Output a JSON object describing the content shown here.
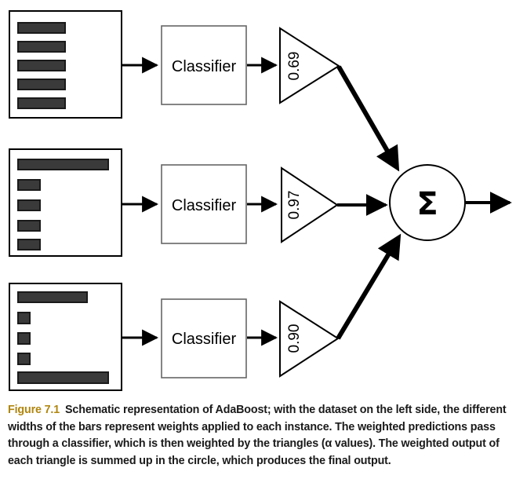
{
  "figure": {
    "label": "Figure 7.1",
    "caption": "Schematic representation of AdaBoost; with the dataset on the left side, the different widths of the bars represent weights applied to each instance. The weighted predictions pass through a classifier, which is then weighted by the triangles (α values). The weighted output of each triangle is summed up in the circle, which produces the final output.",
    "label_color": "#b0860f"
  },
  "diagram": {
    "title": "AdaBoost schematic",
    "bar_color": "#3a3a3a",
    "bar_outline_color": "#1a1a1a",
    "stroke_color": "#000000",
    "box_fill": "#ffffff",
    "rows": [
      {
        "id": "row-1",
        "dataset_label": "dataset-box-1",
        "bars": [
          {
            "label": "weight-bar",
            "width": 60
          },
          {
            "label": "weight-bar",
            "width": 60
          },
          {
            "label": "weight-bar",
            "width": 60
          },
          {
            "label": "weight-bar",
            "width": 60
          },
          {
            "label": "weight-bar",
            "width": 60
          }
        ],
        "classifier_label": "Classifier",
        "alpha_value": "0.69"
      },
      {
        "id": "row-2",
        "dataset_label": "dataset-box-2",
        "bars": [
          {
            "label": "weight-bar",
            "width": 115
          },
          {
            "label": "weight-bar",
            "width": 28
          },
          {
            "label": "weight-bar",
            "width": 28
          },
          {
            "label": "weight-bar",
            "width": 28
          },
          {
            "label": "weight-bar",
            "width": 28
          }
        ],
        "classifier_label": "Classifier",
        "alpha_value": "0.97"
      },
      {
        "id": "row-3",
        "dataset_label": "dataset-box-3",
        "bars": [
          {
            "label": "weight-bar",
            "width": 88
          },
          {
            "label": "weight-bar",
            "width": 15
          },
          {
            "label": "weight-bar",
            "width": 15
          },
          {
            "label": "weight-bar",
            "width": 15
          },
          {
            "label": "weight-bar",
            "width": 115
          }
        ],
        "classifier_label": "Classifier",
        "alpha_value": "0.90"
      }
    ],
    "sum_node": {
      "symbol": "Σ",
      "name": "summation-circle"
    }
  }
}
